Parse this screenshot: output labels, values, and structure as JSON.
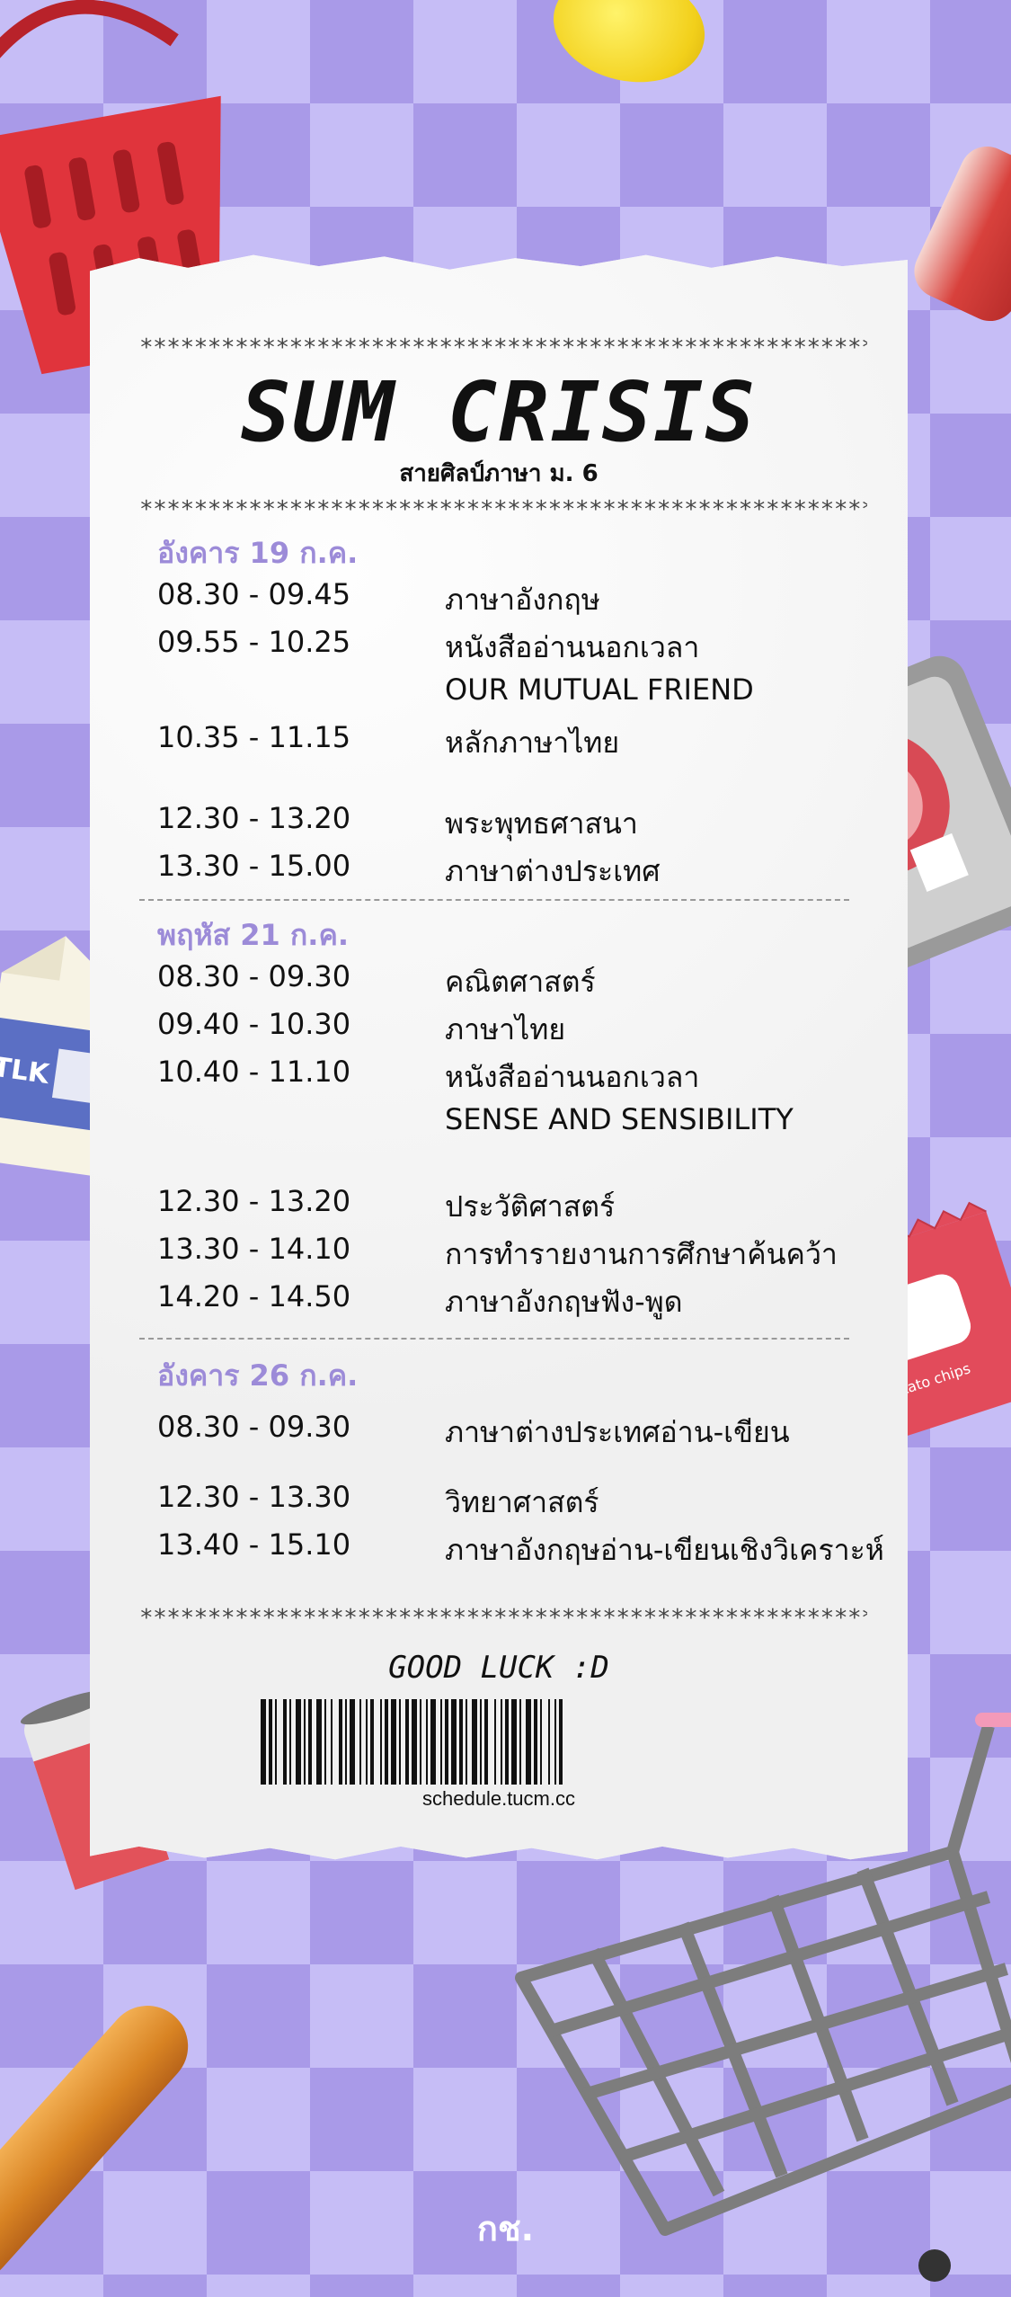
{
  "title": "SUM CRISIS",
  "subtitle": "สายศิลป์ภาษา ม. 6",
  "stars": "**************************************************************",
  "days": [
    {
      "label": "อังคาร 19 ก.ค.",
      "rows": [
        {
          "time": "08.30 - 09.45",
          "subject": "ภาษาอังกฤษ"
        },
        {
          "time": "09.55 - 10.25",
          "subject": "หนังสืออ่านนอกเวลา"
        },
        {
          "time": "",
          "subject": "OUR MUTUAL FRIEND"
        },
        {
          "time": "10.35 - 11.15",
          "subject": "หลักภาษาไทย"
        },
        {
          "time": "12.30 - 13.20",
          "subject": "พระพุทธศาสนา"
        },
        {
          "time": "13.30 - 15.00",
          "subject": "ภาษาต่างประเทศ"
        }
      ]
    },
    {
      "label": "พฤหัส 21 ก.ค.",
      "rows": [
        {
          "time": "08.30 - 09.30",
          "subject": "คณิตศาสตร์"
        },
        {
          "time": "09.40 - 10.30",
          "subject": "ภาษาไทย"
        },
        {
          "time": "10.40 - 11.10",
          "subject": "หนังสืออ่านนอกเวลา"
        },
        {
          "time": "",
          "subject": "SENSE AND SENSIBILITY"
        },
        {
          "time": "12.30 - 13.20",
          "subject": "ประวัติศาสตร์"
        },
        {
          "time": "13.30 - 14.10",
          "subject": "การทำรายงานการศึกษาค้นคว้า"
        },
        {
          "time": "14.20 - 14.50",
          "subject": "ภาษาอังกฤษฟัง-พูด"
        }
      ]
    },
    {
      "label": "อังคาร 26 ก.ค.",
      "rows": [
        {
          "time": "08.30 - 09.30",
          "subject": "ภาษาต่างประเทศอ่าน-เขียน"
        },
        {
          "time": "12.30 - 13.30",
          "subject": "วิทยาศาสตร์"
        },
        {
          "time": "13.40 - 15.10",
          "subject": "ภาษาอังกฤษอ่าน-เขียนเชิงวิเคราะห์"
        }
      ]
    }
  ],
  "footer": {
    "good_luck": "GOOD LUCK :D",
    "site": "schedule.tucm.cc"
  },
  "signature": "กช.",
  "decorations": {
    "milk_label": "TLK",
    "chips_label": "potato chips"
  },
  "colors": {
    "background": "#c6bdf6",
    "checker": "#a99ae8",
    "day_label": "#9c8bd8"
  }
}
